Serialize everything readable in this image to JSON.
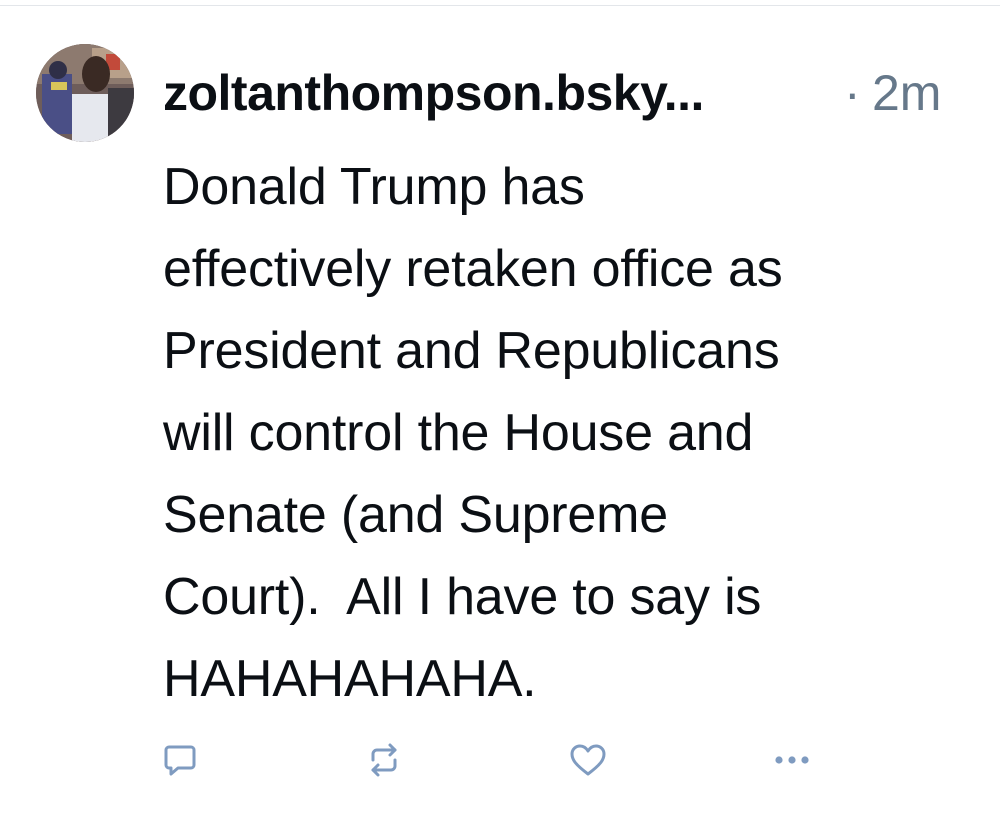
{
  "post": {
    "author_handle": "zoltanthompson.bsky...",
    "separator": "·",
    "timestamp": "2m",
    "text": "Donald Trump has\neffectively retaken office as\nPresident and Republicans\nwill control the House and\nSenate (and Supreme\nCourt).  All I have to say is\nHAHAHAHAHA."
  },
  "actions": [
    {
      "icon": "reply-icon"
    },
    {
      "icon": "repost-icon"
    },
    {
      "icon": "like-heart-icon"
    },
    {
      "icon": "more-options-icon"
    }
  ],
  "colors": {
    "text": "#0b0f14",
    "muted": "#66788a",
    "action_icon": "#7f9bc0",
    "divider": "#e3e6ea"
  }
}
